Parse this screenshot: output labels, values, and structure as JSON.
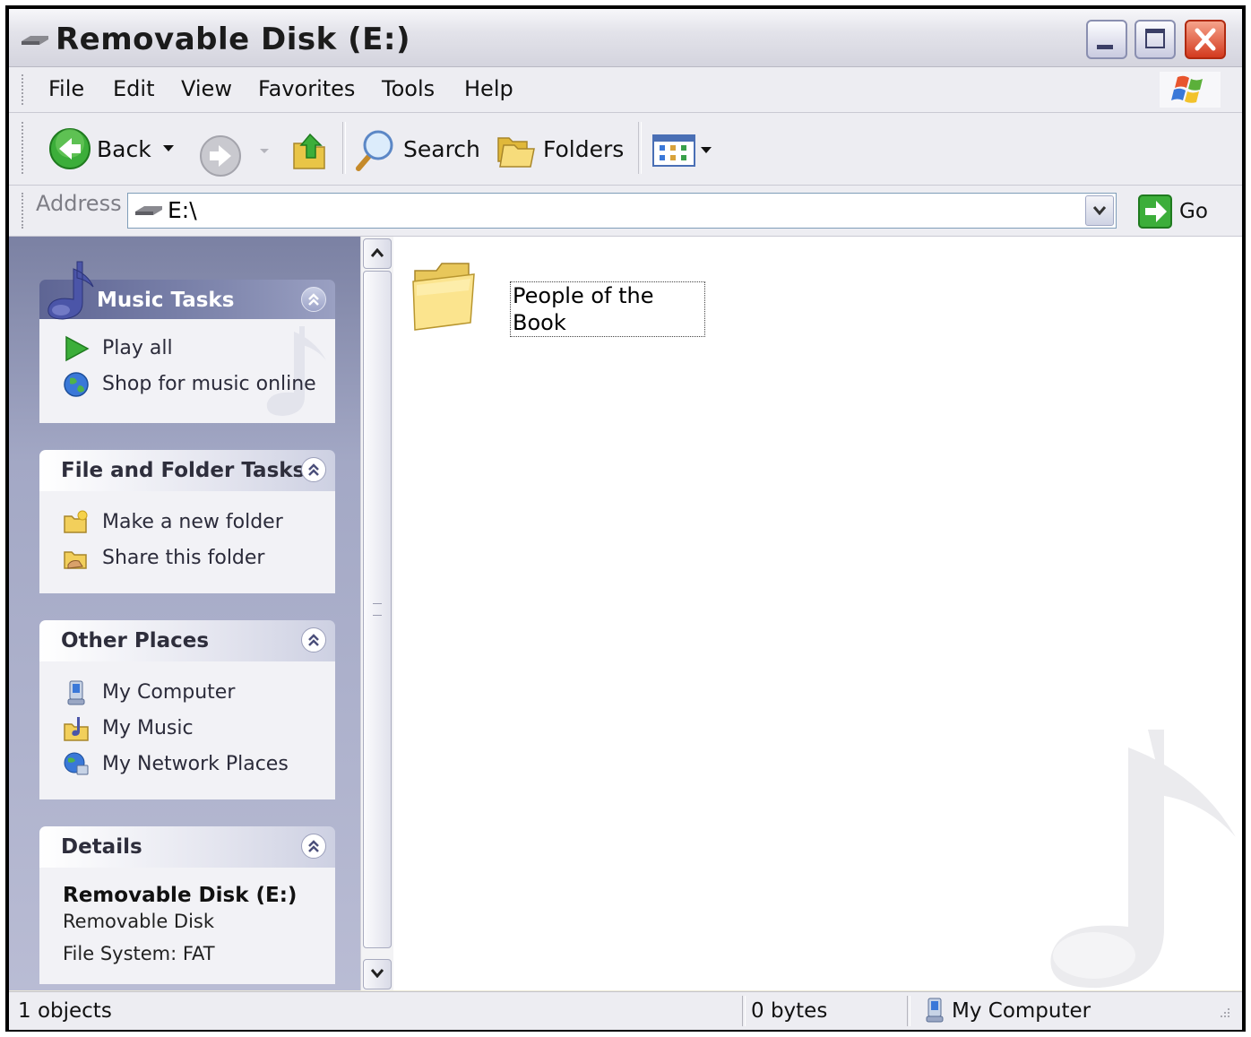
{
  "window": {
    "title": "Removable Disk (E:)"
  },
  "menu": [
    "File",
    "Edit",
    "View",
    "Favorites",
    "Tools",
    "Help"
  ],
  "toolbar": {
    "back_label": "Back",
    "search_label": "Search",
    "folders_label": "Folders"
  },
  "address": {
    "label": "Address",
    "value": "E:\\",
    "go_label": "Go"
  },
  "panels": {
    "music_tasks": {
      "title": "Music Tasks",
      "items": [
        "Play all",
        "Shop for music online"
      ]
    },
    "file_folder_tasks": {
      "title": "File and Folder Tasks",
      "items": [
        "Make a new folder",
        "Share this folder"
      ]
    },
    "other_places": {
      "title": "Other Places",
      "items": [
        "My Computer",
        "My Music",
        "My Network Places"
      ]
    },
    "details": {
      "title": "Details",
      "name": "Removable Disk (E:)",
      "type": "Removable Disk",
      "file_system": "File System: FAT"
    }
  },
  "content": {
    "items": [
      {
        "name": "People of the Book",
        "icon": "folder-icon"
      }
    ]
  },
  "status": {
    "objects": "1 objects",
    "size": "0 bytes",
    "location": "My Computer"
  }
}
